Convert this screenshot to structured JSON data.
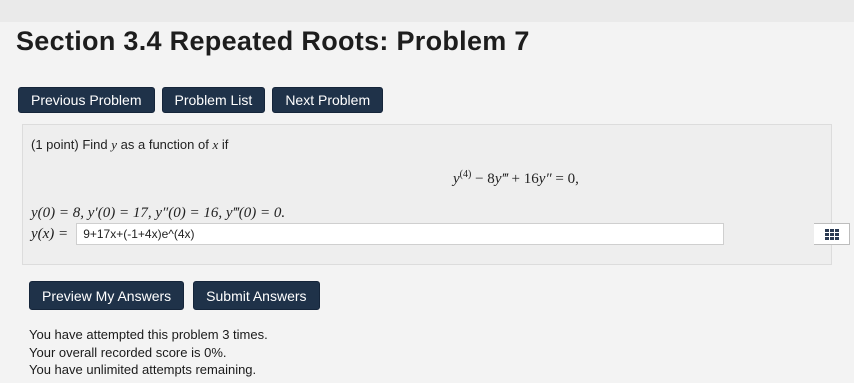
{
  "page": {
    "title": "Section 3.4 Repeated Roots: Problem 7"
  },
  "nav": {
    "previous": "Previous Problem",
    "list": "Problem List",
    "next": "Next Problem"
  },
  "problem": {
    "points": "(1 point)",
    "find": "Find",
    "var_y": "y",
    "as_fn": "as a function of",
    "var_x": "x",
    "if_word": "if",
    "equation": {
      "y4": "y",
      "y4_sup": "(4)",
      "minus": " − 8",
      "y3": "y‴",
      "plus": " + 16",
      "y2": "y″",
      "rhs": " = 0,"
    },
    "initial_conditions": "y(0) = 8,  y′(0) = 17,  y″(0) = 16,  y‴(0) = 0.",
    "answer_label": "y(x) =",
    "answer_value": "9+17x+(-1+4x)e^(4x)"
  },
  "actions": {
    "preview": "Preview My Answers",
    "submit": "Submit Answers"
  },
  "status": {
    "attempted": "You have attempted this problem 3 times.",
    "score": "Your overall recorded score is 0%.",
    "remaining": "You have unlimited attempts remaining."
  },
  "icons": {
    "palette": "equation-editor-icon"
  },
  "colors": {
    "button_dark": "#1f3249",
    "button_light": "#e8eaee",
    "background": "#f3f3f3",
    "problem_box": "#eeeeee"
  }
}
